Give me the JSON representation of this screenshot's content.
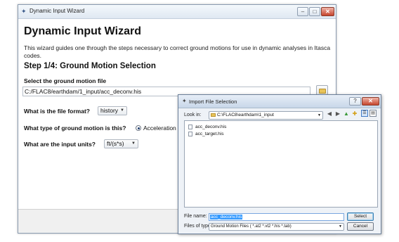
{
  "wizard": {
    "window_title": "Dynamic Input Wizard",
    "controls": {
      "minimize": "–",
      "maximize": "□",
      "close": "✕"
    },
    "heading": "Dynamic Input Wizard",
    "description": "This wizard guides one through the steps necessary to correct ground motions for use in dynamic analyses in Itasca codes.",
    "step_title": "Step 1/4: Ground Motion Selection",
    "file_label": "Select the ground motion file",
    "file_path": "C:/FLAC8/earthdam/1_input/acc_deconv.his",
    "format_label": "What is the file format?",
    "format_value": "history",
    "motion_type_label": "What type of ground motion is this?",
    "motion_type_value": "Acceleration",
    "units_label": "What are the input units?",
    "units_value": "ft/(s*s)"
  },
  "dialog": {
    "title": "Import File Selection",
    "controls": {
      "help": "?",
      "close": "✕"
    },
    "look_in_label": "Look in:",
    "look_in_value": "C:\\FLAC8\\earthdam\\1_input",
    "nav_icons": [
      "back-icon",
      "forward-icon",
      "up-folder-icon",
      "new-folder-icon",
      "list-view-icon",
      "detail-view-icon"
    ],
    "files": [
      {
        "name": "acc_deconv.his"
      },
      {
        "name": "acc_target.his"
      }
    ],
    "file_name_label": "File name:",
    "file_name_value": "acc_deconv.his",
    "file_type_label": "Files of type:",
    "file_type_value": "Ground Motion Files ( *.at2 *.vt2 *.his *.tab)",
    "select_label": "Select",
    "cancel_label": "Cancel"
  },
  "colors": {
    "selection": "#3399ff",
    "folder": "#e9c45a",
    "close_button": "#c6452d"
  }
}
